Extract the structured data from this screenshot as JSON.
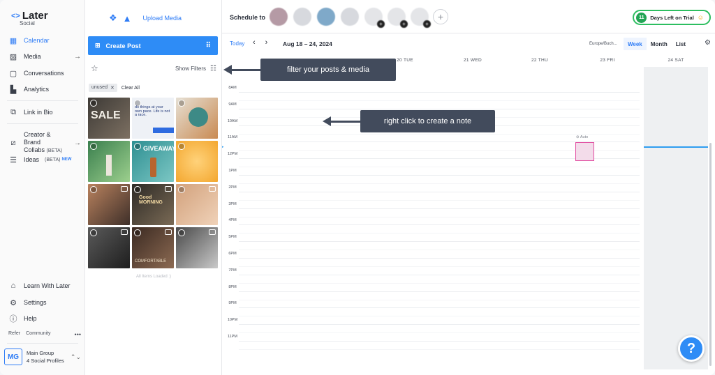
{
  "brand": {
    "name": "Later",
    "sub": "Social"
  },
  "sidebar": {
    "items": [
      {
        "label": "Calendar",
        "icon": "calendar-icon",
        "active": true
      },
      {
        "label": "Media",
        "icon": "image-icon"
      },
      {
        "label": "Conversations",
        "icon": "chat-icon"
      },
      {
        "label": "Analytics",
        "icon": "analytics-icon"
      },
      {
        "label": "Link in Bio",
        "icon": "link-icon"
      },
      {
        "label": "Creator & Brand",
        "label2": "Collabs",
        "beta": "(BETA)",
        "icon": "collab-icon"
      },
      {
        "label": "Ideas",
        "beta": "(BETA)",
        "new": "NEW",
        "icon": "ideas-icon"
      }
    ],
    "bottom": [
      {
        "label": "Learn With Later",
        "icon": "book-icon"
      },
      {
        "label": "Settings",
        "icon": "gear-icon"
      },
      {
        "label": "Help",
        "icon": "help-icon"
      }
    ],
    "refer": "Refer",
    "community": "Community",
    "group": {
      "initials": "MG",
      "name": "Main Group",
      "profiles": "4 Social Profiles"
    }
  },
  "media": {
    "upload_label": "Upload Media",
    "create_post": "Create Post",
    "show_filters": "Show Filters",
    "chip": "unused",
    "clear_all": "Clear All",
    "loaded": "All Items Loaded :)",
    "thumbs": [
      {
        "t": "SALE"
      },
      {
        "t": "do things at your own pace. Life is not a race."
      },
      {
        "t": ""
      },
      {
        "t": ""
      },
      {
        "t": "GIVEAWAY"
      },
      {
        "t": ""
      },
      {
        "t": ""
      },
      {
        "t": "Good MORNING"
      },
      {
        "t": ""
      },
      {
        "t": ""
      },
      {
        "t": "COMFORTABLE"
      },
      {
        "t": ""
      }
    ]
  },
  "topbar": {
    "schedule_to": "Schedule to",
    "trial_days": "11",
    "trial_label": "Days Left on Trial"
  },
  "calendar": {
    "today": "Today",
    "range": "Aug 18 – 24, 2024",
    "timezone": "Europe/Buch...",
    "views": [
      "Week",
      "Month",
      "List"
    ],
    "active_view": "Week",
    "days": [
      "20 TUE",
      "21 WED",
      "22 THU",
      "23 FRI",
      "24 SAT"
    ],
    "hours": [
      "8AM",
      "9AM",
      "10AM",
      "11AM",
      "12PM",
      "1PM",
      "2PM",
      "3PM",
      "4PM",
      "5PM",
      "6PM",
      "7PM",
      "8PM",
      "9PM",
      "10PM",
      "11PM"
    ],
    "auto_tag": "Auto"
  },
  "callouts": {
    "filter": "filter your posts & media",
    "note": "right click to create a note"
  },
  "colors": {
    "accent": "#2e8cf6",
    "trial_green": "#23a455",
    "callout_bg": "#424b5c",
    "post_pink": "#e14ba0"
  }
}
